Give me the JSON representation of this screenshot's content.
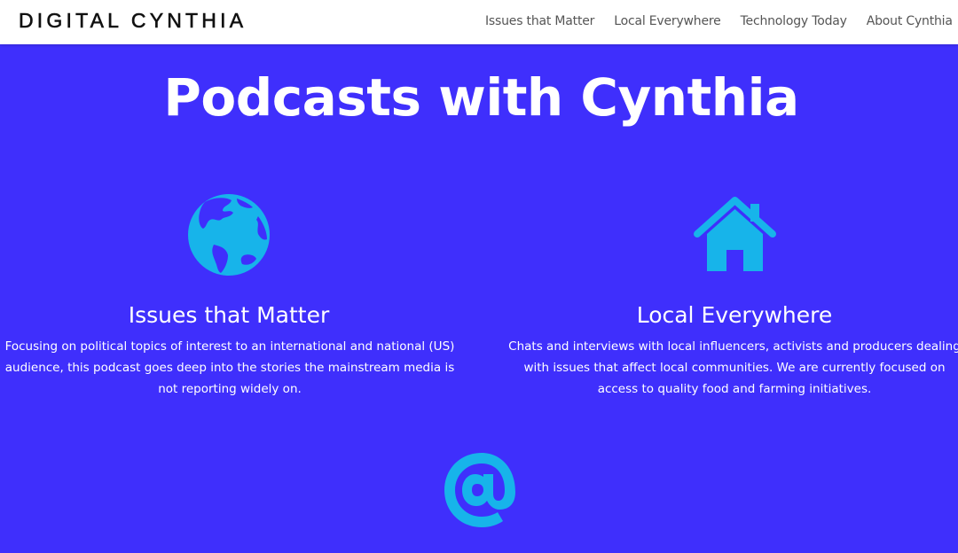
{
  "header": {
    "logo": "DIGITAL CYNTHIA",
    "nav": [
      {
        "label": "Issues that Matter"
      },
      {
        "label": "Local Everywhere"
      },
      {
        "label": "Technology Today"
      },
      {
        "label": "About Cynthia"
      }
    ]
  },
  "main": {
    "title": "Podcasts with Cynthia",
    "columns": [
      {
        "icon": "globe-icon",
        "title": "Issues that Matter",
        "text": "Focusing on political topics of interest to an international and national (US) audience, this podcast goes deep into the stories the mainstream media is not reporting widely on."
      },
      {
        "icon": "home-icon",
        "title": "Local Everywhere",
        "text": "Chats and interviews with local influencers, activists and producers dealing with issues that affect local communities. We are currently focused on access to quality food and farming initiatives."
      },
      {
        "icon": "at-sign-icon"
      }
    ]
  },
  "colors": {
    "background": "#3f2ffc",
    "icon": "#17b4ea",
    "header_bg": "#ffffff",
    "nav_text": "#555555"
  }
}
